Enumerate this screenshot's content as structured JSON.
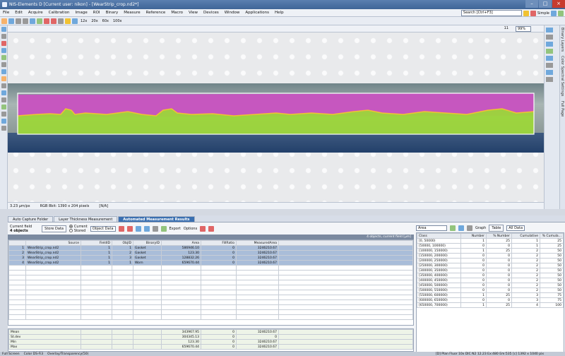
{
  "window": {
    "title": "NIS-Elements D [Current user: nikon] - [WearStrip_crop.nd2*]",
    "controls": [
      "–",
      "□",
      "×"
    ]
  },
  "menu": {
    "items": [
      "File",
      "Edit",
      "Acquire",
      "Calibration",
      "Image",
      "ROI",
      "Binary",
      "Measure",
      "Reference",
      "Macro",
      "View",
      "Devices",
      "Window",
      "Applications",
      "Help"
    ],
    "search_placeholder": "Search [Ctrl+F3]",
    "layout_label": "Simple"
  },
  "toolbar": {
    "zoom_buttons": [
      "12x",
      "20x",
      "60x",
      "100x"
    ],
    "zoom_value": "99%",
    "frame_counter": "11"
  },
  "right_labels": [
    "Binary Layers",
    "Color Spectral Settings",
    "Full Page"
  ],
  "image_status": {
    "calibration": "3.23 µm/px",
    "format": "RGB 8bit: 1390 x 204 pixels",
    "cursor": "[N/A]"
  },
  "tabs": [
    {
      "label": "Auto Capture Folder",
      "active": false
    },
    {
      "label": "Layer Thickness Measurement",
      "active": false
    },
    {
      "label": "Automated Measurement Results",
      "active": true
    }
  ],
  "results": {
    "current_field_label": "Current field",
    "object_count": "4 objects",
    "store_button": "Store Data",
    "radio_current": "Current",
    "radio_stored": "Stored",
    "object_data_select": "Object Data",
    "export_label": "Export",
    "options_label": "Options",
    "info_text": "4 objects, current field [µm]",
    "columns": [
      "",
      "Source",
      "FieldID",
      "ObjID",
      "BinaryID",
      "Area",
      "FillRatio",
      "MeasuredArea"
    ],
    "rows": [
      [
        "1",
        "WearStrip_crop.nd2",
        "1",
        "1",
        "Gasket",
        "586946.10",
        "0",
        "3246210.67"
      ],
      [
        "2",
        "WearStrip_crop.nd2",
        "1",
        "2",
        "Gasket",
        "123.30",
        "0",
        "3246210.67"
      ],
      [
        "3",
        "WearStrip_crop.nd2",
        "1",
        "3",
        "Gasket",
        "128832.26",
        "0",
        "3246210.67"
      ],
      [
        "4",
        "WearStrip_crop.nd2",
        "1",
        "1",
        "Worn",
        "659670.44",
        "0",
        "3246210.67"
      ]
    ],
    "stats": [
      [
        "Mean",
        "343967.95",
        "0",
        "3246210.67"
      ],
      [
        "St.dev",
        "304345.13",
        "0",
        "0"
      ],
      [
        "Min",
        "123.30",
        "0",
        "3246210.67"
      ],
      [
        "Max",
        "659670.44",
        "0",
        "3246210.67"
      ]
    ]
  },
  "histogram": {
    "feature_select": "Area",
    "graph_label": "Graph",
    "table_label": "Table",
    "data_select": "All Data",
    "columns": [
      "Class",
      "Number",
      "% Number",
      "Cumulative",
      "% Cumula..."
    ],
    "rows": [
      [
        "[0, 50000)",
        "1",
        "25",
        "1",
        "25"
      ],
      [
        "[50000, 100000)",
        "0",
        "0",
        "1",
        "25"
      ],
      [
        "[100000, 150000)",
        "1",
        "25",
        "2",
        "50"
      ],
      [
        "[150000, 200000)",
        "0",
        "0",
        "2",
        "50"
      ],
      [
        "[200000, 250000)",
        "0",
        "0",
        "2",
        "50"
      ],
      [
        "[250000, 300000)",
        "0",
        "0",
        "2",
        "50"
      ],
      [
        "[300000, 350000)",
        "0",
        "0",
        "2",
        "50"
      ],
      [
        "[350000, 400000)",
        "0",
        "0",
        "2",
        "50"
      ],
      [
        "[400000, 450000)",
        "0",
        "0",
        "2",
        "50"
      ],
      [
        "[450000, 500000)",
        "0",
        "0",
        "2",
        "50"
      ],
      [
        "[500000, 550000)",
        "0",
        "0",
        "2",
        "50"
      ],
      [
        "[550000, 600000)",
        "1",
        "25",
        "3",
        "75"
      ],
      [
        "[600000, 650000)",
        "0",
        "0",
        "3",
        "75"
      ],
      [
        "[650000, 700000)",
        "1",
        "25",
        "4",
        "100"
      ]
    ]
  },
  "statusbar": {
    "items": [
      "Full Screen",
      "Color DS-Fi3",
      "Overlay/Transparency(50)",
      "[D] Plan Fluor 10x DIC N2 12.23 Ex:480 Em:535 [c] 1392 x 1040 pix"
    ]
  },
  "colors": {
    "accent": "#3a6fb0",
    "overlay_magenta": "#c94fc0",
    "overlay_green": "#9cd63a"
  }
}
